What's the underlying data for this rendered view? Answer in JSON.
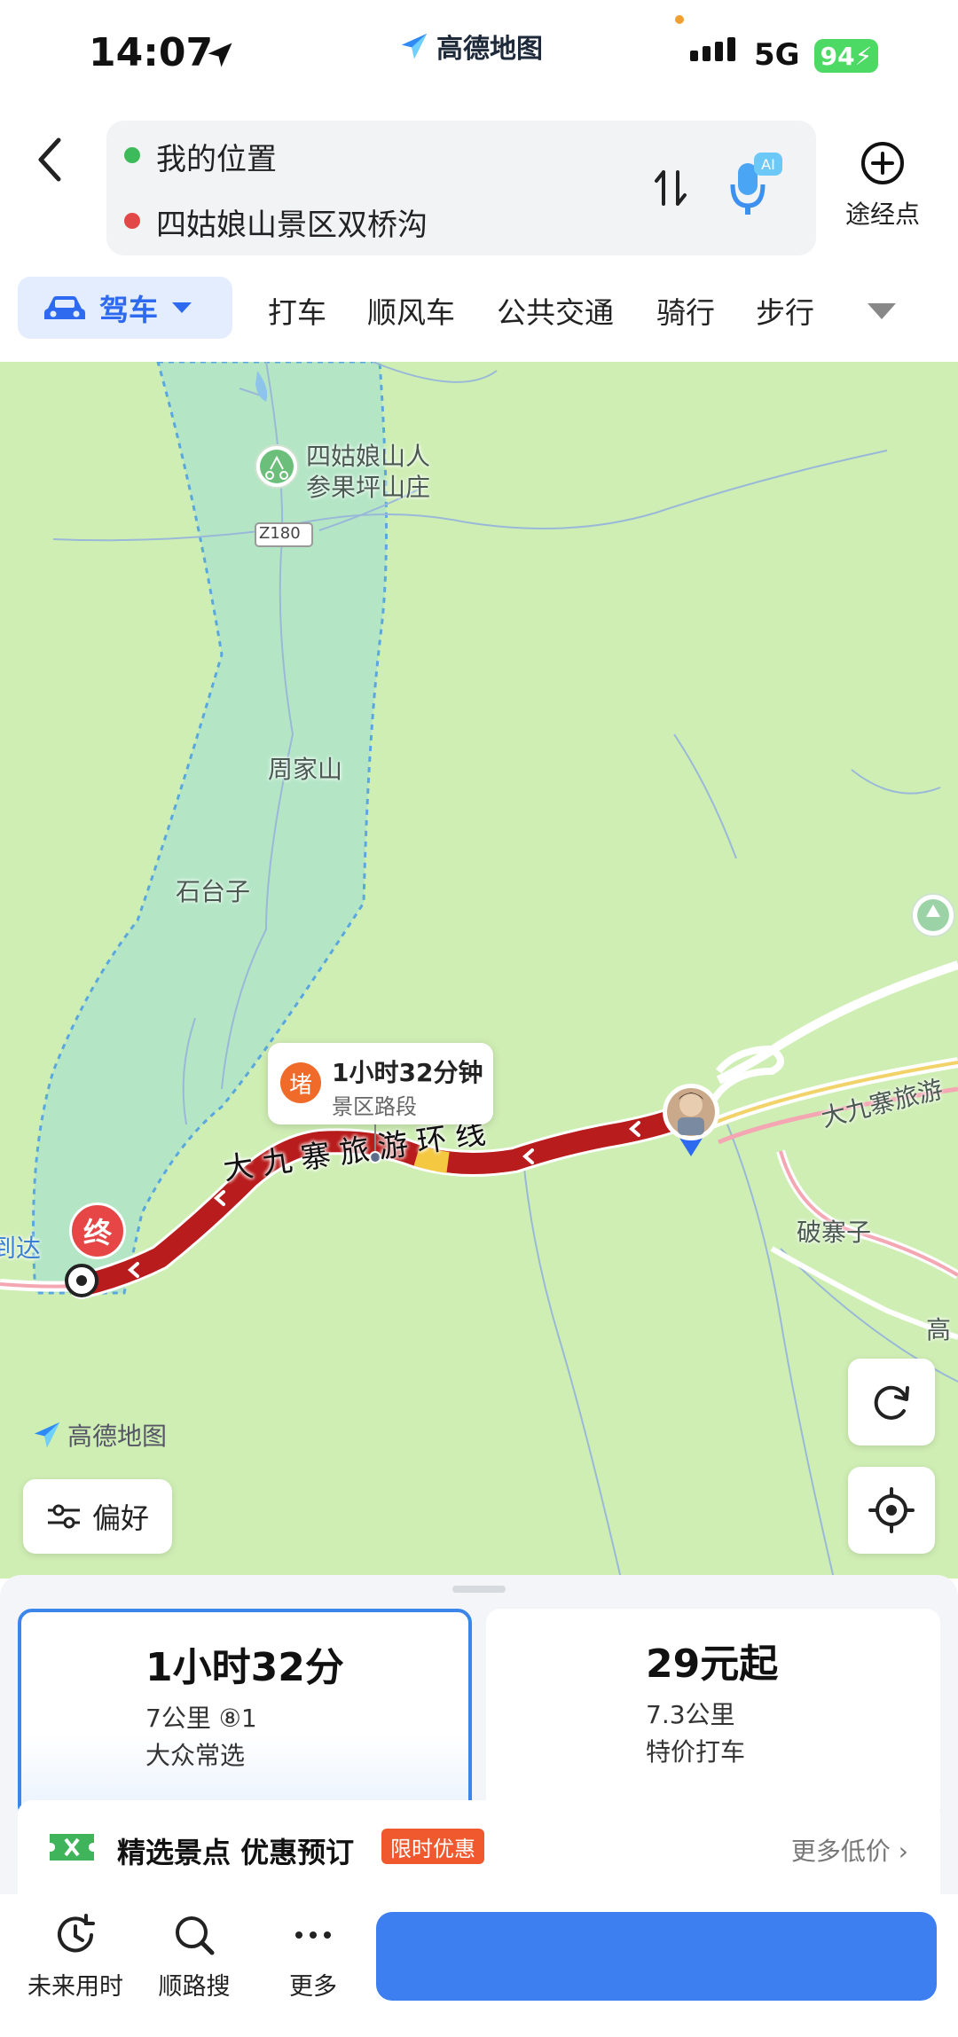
{
  "status_bar": {
    "time": "14:07",
    "app_name": "高德地图",
    "network": "5G",
    "battery": "94"
  },
  "route": {
    "origin": "我的位置",
    "destination": "四姑娘山景区双桥沟",
    "via_label": "途经点",
    "origin_dot_color": "#3dbb5a",
    "dest_dot_color": "#e34848"
  },
  "modes": {
    "active": "驾车",
    "tabs": [
      "打车",
      "顺风车",
      "公共交通",
      "骑行",
      "步行"
    ]
  },
  "map": {
    "labels": {
      "poi_line1": "四姑娘山人",
      "poi_line2": "参果坪山庄",
      "road_code": "Z180",
      "village1": "周家山",
      "village2": "石台子",
      "village3": "破寨子",
      "road_name": "大九寨旅游环线",
      "road_name_right": "大九寨旅游",
      "edge_left": "到达",
      "edge_right": "高"
    },
    "callout": {
      "badge": "堵",
      "title": "1小时32分钟",
      "subtitle": "景区路段"
    },
    "end_marker": "终",
    "brand": "高德地图",
    "preference_button": "偏好"
  },
  "options": [
    {
      "title": "1小时32分",
      "line2": "7公里 ⑧1",
      "line3": "大众常选",
      "selected": true
    },
    {
      "title": "29元起",
      "line2": "7.3公里",
      "line3": "特价打车",
      "selected": false
    }
  ],
  "promo": {
    "title": "精选景点 优惠预订",
    "badge": "限时优惠",
    "more": "更多低价 ›"
  },
  "bottom_bar": {
    "items": [
      "未来用时",
      "顺路搜",
      "更多"
    ],
    "start_button_color": "#3d7ff0"
  },
  "colors": {
    "accent": "#2d6af0",
    "route_congested": "#b81c1c",
    "map_land": "#cfeeb4",
    "scenic_area": "#b4e6c6"
  },
  "icons": [
    "location-arrow-icon",
    "back-icon",
    "swap-icon",
    "ai-mic-icon",
    "plus-circle-icon",
    "car-icon",
    "caret-down-icon",
    "refresh-icon",
    "locate-icon",
    "settings-sliders-icon",
    "clock-icon",
    "search-icon",
    "more-dots-icon",
    "ticket-icon"
  ]
}
